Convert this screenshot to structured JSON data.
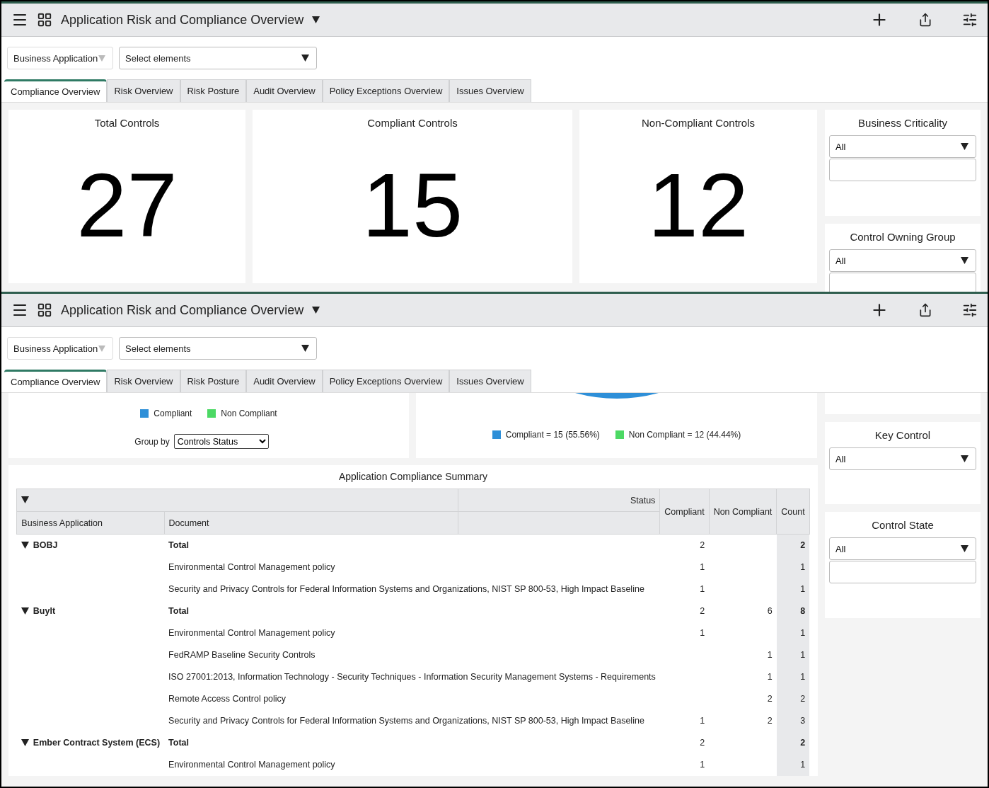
{
  "screens": [
    {
      "header": {
        "title": "Application Risk and Compliance Overview"
      },
      "filters": {
        "application": {
          "label": "Business Application"
        },
        "elements": {
          "placeholder": "Select elements"
        }
      },
      "tabs": [
        {
          "label": "Compliance Overview",
          "selected": true
        },
        {
          "label": "Risk Overview",
          "selected": false
        },
        {
          "label": "Risk Posture",
          "selected": false
        },
        {
          "label": "Audit Overview",
          "selected": false
        },
        {
          "label": "Policy Exceptions Overview",
          "selected": false
        },
        {
          "label": "Issues Overview",
          "selected": false
        }
      ],
      "kpis": [
        {
          "title": "Total Controls",
          "value": "27"
        },
        {
          "title": "Compliant Controls",
          "value": "15"
        },
        {
          "title": "Non-Compliant Controls",
          "value": "12"
        }
      ],
      "sidebar": {
        "filters": [
          {
            "title": "Business Criticality",
            "value": "All",
            "has_search": true
          },
          {
            "title": "Control Owning Group",
            "value": "All",
            "has_search": true
          }
        ]
      }
    },
    {
      "header": {
        "title": "Application Risk and Compliance Overview"
      },
      "filters": {
        "application": {
          "label": "Business Application"
        },
        "elements": {
          "placeholder": "Select elements"
        }
      },
      "tabs": [
        {
          "label": "Compliance Overview",
          "selected": true
        },
        {
          "label": "Risk Overview",
          "selected": false
        },
        {
          "label": "Risk Posture",
          "selected": false
        },
        {
          "label": "Audit Overview",
          "selected": false
        },
        {
          "label": "Policy Exceptions Overview",
          "selected": false
        },
        {
          "label": "Issues Overview",
          "selected": false
        }
      ],
      "status_chart": {
        "legend": [
          {
            "label": "Compliant",
            "color": "#2e8fd8"
          },
          {
            "label": "Non Compliant",
            "color": "#4cd964"
          }
        ],
        "group_by": {
          "label": "Group by",
          "value": "Controls Status"
        }
      },
      "pie_chart": {
        "legend": [
          {
            "label": "Compliant = 15 (55.56%)",
            "color": "#2e8fd8"
          },
          {
            "label": "Non Compliant = 12 (44.44%)",
            "color": "#4cd964"
          }
        ]
      },
      "summary": {
        "title": "Application Compliance Summary",
        "columns": {
          "business_application": "Business Application",
          "document": "Document",
          "status": "Status",
          "compliant": "Compliant",
          "non_compliant": "Non Compliant",
          "count": "Count"
        },
        "groups": [
          {
            "name": "BOBJ",
            "expanded": true,
            "rows": [
              {
                "kind": "total",
                "document": "Total",
                "compliant": "2",
                "count": "2"
              },
              {
                "kind": "item",
                "document": "Environmental Control Management policy",
                "compliant": "1",
                "count": "1"
              },
              {
                "kind": "item",
                "document": "Security and Privacy Controls for Federal Information Systems and Organizations, NIST SP 800-53, High Impact Baseline",
                "compliant": "1",
                "count": "1"
              }
            ]
          },
          {
            "name": "BuyIt",
            "expanded": true,
            "rows": [
              {
                "kind": "total",
                "document": "Total",
                "compliant": "2",
                "non_compliant": "6",
                "count": "8"
              },
              {
                "kind": "item",
                "document": "Environmental Control Management policy",
                "compliant": "1",
                "count": "1"
              },
              {
                "kind": "item",
                "document": "FedRAMP Baseline Security Controls",
                "non_compliant": "1",
                "count": "1"
              },
              {
                "kind": "item",
                "document": "ISO 27001:2013, Information Technology - Security Techniques - Information Security Management Systems - Requirements",
                "non_compliant": "1",
                "count": "1"
              },
              {
                "kind": "item",
                "document": "Remote Access Control policy",
                "non_compliant": "2",
                "count": "2"
              },
              {
                "kind": "item",
                "document": "Security and Privacy Controls for Federal Information Systems and Organizations, NIST SP 800-53, High Impact Baseline",
                "compliant": "1",
                "non_compliant": "2",
                "count": "3"
              }
            ]
          },
          {
            "name": "Ember Contract System (ECS)",
            "expanded": true,
            "rows": [
              {
                "kind": "total",
                "document": "Total",
                "compliant": "2",
                "count": "2"
              },
              {
                "kind": "item",
                "document": "Environmental Control Management policy",
                "compliant": "1",
                "count": "1"
              }
            ]
          }
        ]
      },
      "sidebar": {
        "leading_blank_card": true,
        "filters": [
          {
            "title": "Key Control",
            "value": "All",
            "has_search": false
          },
          {
            "title": "Control State",
            "value": "All",
            "has_search": true
          }
        ]
      }
    }
  ]
}
